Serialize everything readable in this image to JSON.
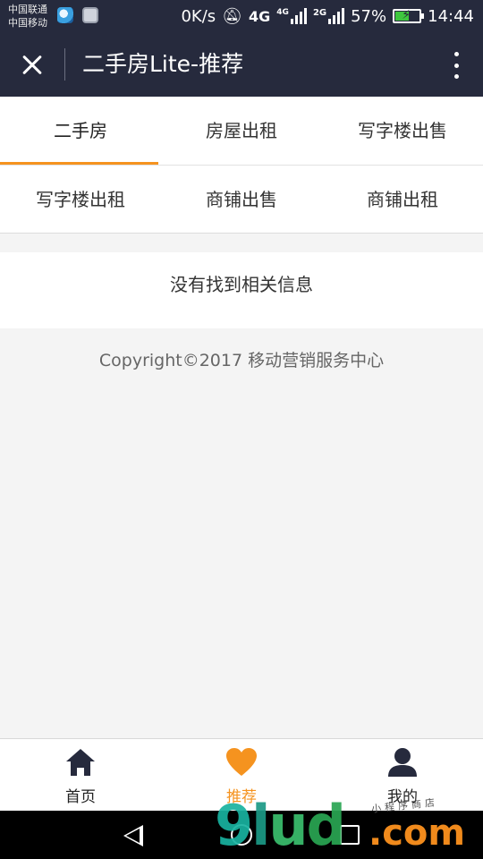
{
  "status_bar": {
    "carrier_1": "中国联通",
    "carrier_2": "中国移动",
    "network_speed": "0K/s",
    "network_1": "4G",
    "network_1_small": "4G",
    "network_2": "2G",
    "battery_percent_text": "57%",
    "battery_level": 0.57,
    "time": "14:44"
  },
  "app_bar": {
    "title": "二手房Lite-推荐",
    "close_icon": "close-icon",
    "more_icon": "more-vertical-icon"
  },
  "tabs": [
    {
      "label": "二手房",
      "active": true
    },
    {
      "label": "房屋出租",
      "active": false
    },
    {
      "label": "写字楼出售",
      "active": false
    },
    {
      "label": "写字楼出租",
      "active": false
    },
    {
      "label": "商铺出售",
      "active": false
    },
    {
      "label": "商铺出租",
      "active": false
    }
  ],
  "content": {
    "empty_message": "没有找到相关信息",
    "copyright": "Copyright©2017 移动营销服务中心"
  },
  "bottom_nav": [
    {
      "label": "首页",
      "icon": "home-icon",
      "active": false
    },
    {
      "label": "推荐",
      "icon": "heart-icon",
      "active": true
    },
    {
      "label": "我的",
      "icon": "user-icon",
      "active": false
    }
  ],
  "system_nav": {
    "back_icon": "back-triangle-icon",
    "home_icon": "home-circle-icon",
    "recent_icon": "recent-square-icon"
  },
  "watermark": {
    "logo": "9lud",
    "domain": ".com",
    "tagline": "小程序商店"
  },
  "colors": {
    "header_bg": "#262a3d",
    "accent": "#f5931f",
    "page_bg": "#f4f4f4",
    "nav_icon": "#262a3d"
  }
}
